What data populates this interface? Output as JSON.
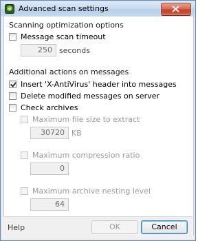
{
  "window": {
    "title": "Advanced scan settings"
  },
  "scan_optimization": {
    "section_title": "Scanning optimization options",
    "message_timeout": {
      "label": "Message scan timeout",
      "checked": false,
      "value": "250",
      "unit": "seconds"
    }
  },
  "additional_actions": {
    "section_title": "Additional actions on messages",
    "insert_header": {
      "label": "Insert 'X-AntiVirus' header into messages",
      "checked": true
    },
    "delete_modified": {
      "label": "Delete modified messages on server",
      "checked": false
    },
    "check_archives": {
      "label": "Check archives",
      "checked": false
    }
  },
  "archive_options": {
    "max_file_size": {
      "label": "Maximum file size to extract",
      "value": "30720",
      "unit": "KB",
      "enabled": false
    },
    "max_compression": {
      "label": "Maximum compression ratio",
      "value": "0",
      "enabled": false
    },
    "max_nesting": {
      "label": "Maximum archive nesting level",
      "value": "64",
      "enabled": false
    }
  },
  "footer": {
    "help_label": "Help",
    "ok_label": "OK",
    "cancel_label": "Cancel"
  },
  "colors": {
    "titlebar": "#c9dcf0",
    "close_button": "#c3402a",
    "cancel_focus_border": "#3c7fb1"
  }
}
